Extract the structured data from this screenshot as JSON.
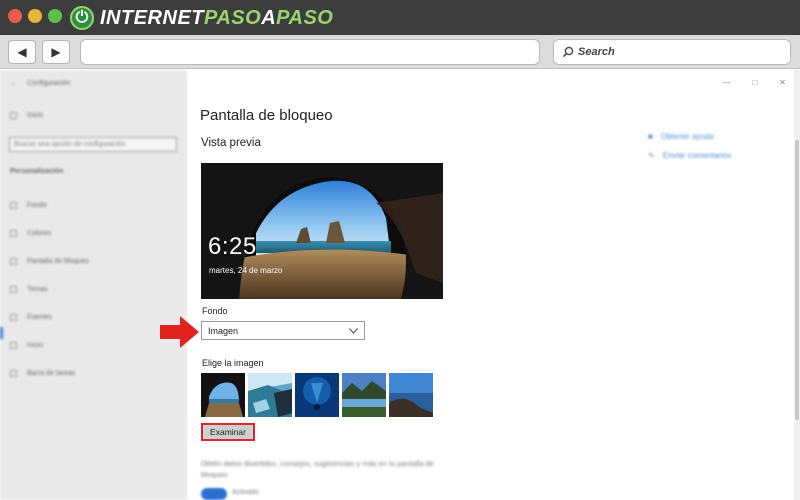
{
  "browser": {
    "logo_text_1": "INTERNET",
    "logo_text_2": "PASO",
    "logo_text_3": "A",
    "logo_text_4": "PASO",
    "search_placeholder": "Search",
    "back_icon": "back-arrow-icon",
    "forward_icon": "forward-arrow-icon",
    "dot_colors": [
      "#e95c52",
      "#e8b43c",
      "#5ebf4a"
    ]
  },
  "sidebar": {
    "title": "Configuración",
    "home": "Inicio",
    "search_placeholder": "Buscar una opción de configuración",
    "section": "Personalización",
    "items": [
      {
        "label": "Fondo"
      },
      {
        "label": "Colores"
      },
      {
        "label": "Pantalla de bloqueo"
      },
      {
        "label": "Temas"
      },
      {
        "label": "Fuentes"
      },
      {
        "label": "Inicio"
      },
      {
        "label": "Barra de tareas"
      }
    ],
    "selected_index": 2
  },
  "main": {
    "title": "Pantalla de bloqueo",
    "preview_label": "Vista previa",
    "preview_time": "6:25",
    "preview_date": "martes, 24 de marzo",
    "fondo_label": "Fondo",
    "fondo_value": "Imagen",
    "elige_label": "Elige la imagen",
    "examinar_label": "Examinar",
    "fun_facts_text": "Obtén datos divertidos, consejos, sugerencias y más en tu pantalla de bloqueo",
    "toggle_label": "Activado",
    "help_links": [
      "Obtener ayuda",
      "Enviar comentarios"
    ],
    "window_controls": [
      "—",
      "□",
      "✕"
    ]
  },
  "colors": {
    "accent": "#2c6fd0",
    "highlight_red": "#d42b2b"
  }
}
